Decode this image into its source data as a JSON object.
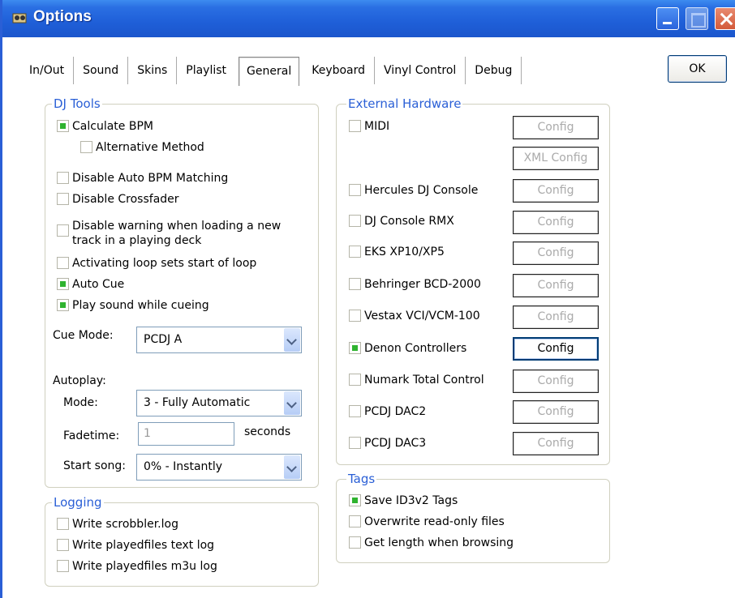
{
  "window": {
    "title": "Options"
  },
  "tabs": [
    {
      "label": "In/Out"
    },
    {
      "label": "Sound"
    },
    {
      "label": "Skins"
    },
    {
      "label": "Playlist"
    },
    {
      "label": "General"
    },
    {
      "label": "Keyboard"
    },
    {
      "label": "Vinyl Control"
    },
    {
      "label": "Debug"
    }
  ],
  "active_tab": "General",
  "ok_label": "OK",
  "dj_tools": {
    "title": "DJ Tools",
    "calculate_bpm": "Calculate BPM",
    "alternative_method": "Alternative Method",
    "disable_auto_bpm": "Disable Auto BPM Matching",
    "disable_crossfader": "Disable Crossfader",
    "disable_warning_line1": "Disable warning when loading a new",
    "disable_warning_line2": "track in a playing deck",
    "activating_loop": "Activating loop sets start of loop",
    "auto_cue": "Auto Cue",
    "play_sound_cueing": "Play sound while cueing",
    "cue_mode_label": "Cue Mode:",
    "cue_mode_value": "PCDJ A",
    "autoplay_label": "Autoplay:",
    "mode_label": "Mode:",
    "mode_value": "3 - Fully Automatic",
    "fadetime_label": "Fadetime:",
    "fadetime_value": "1",
    "seconds_label": "seconds",
    "start_song_label": "Start song:",
    "start_song_value": "0% - Instantly"
  },
  "logging": {
    "title": "Logging",
    "scrobbler": "Write scrobbler.log",
    "playedfiles_text": "Write playedfiles text log",
    "playedfiles_m3u": "Write playedfiles m3u log"
  },
  "external_hardware": {
    "title": "External Hardware",
    "config_label": "Config",
    "xml_config_label": "XML Config",
    "devices": [
      {
        "name": "MIDI"
      },
      {
        "name": "Hercules DJ Console"
      },
      {
        "name": "DJ Console RMX"
      },
      {
        "name": "EKS XP10/XP5"
      },
      {
        "name": "Behringer BCD-2000"
      },
      {
        "name": "Vestax VCI/VCM-100"
      },
      {
        "name": "Denon Controllers"
      },
      {
        "name": "Numark Total Control"
      },
      {
        "name": "PCDJ DAC2"
      },
      {
        "name": "PCDJ DAC3"
      }
    ]
  },
  "tags": {
    "title": "Tags",
    "save_id3v2": "Save ID3v2 Tags",
    "overwrite_readonly": "Overwrite read-only files",
    "get_length": "Get length when browsing"
  },
  "colors": {
    "titlebar": "#1f5fd8",
    "group_label": "#2a5fd6",
    "check_fill": "#2fb32f"
  }
}
